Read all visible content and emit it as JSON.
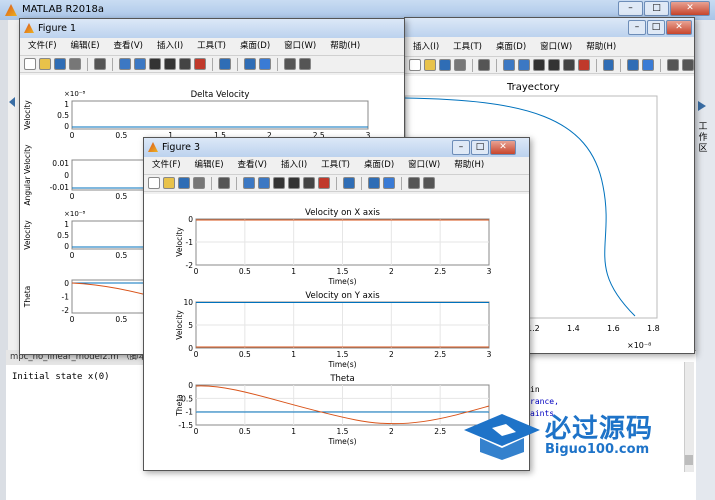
{
  "app": {
    "title": "MATLAB R2018a"
  },
  "side_panel_label": "工作区",
  "editor": {
    "tab_label": "mpc_no_linear_model2.m （脚本）",
    "line1": "Initial state x(0)",
    "frag1": "in",
    "frag2": "rance,",
    "frag3": "aints"
  },
  "menu": [
    "文件(F)",
    "编辑(E)",
    "查看(V)",
    "插入(I)",
    "工具(T)",
    "桌面(D)",
    "窗口(W)",
    "帮助(H)"
  ],
  "fig_back": {
    "title": "",
    "plot_title": "Trayectory",
    "x_ticks": [
      "1.2",
      "1.4",
      "1.6",
      "1.8"
    ],
    "x_exponent": "×10⁻⁸",
    "curve_color": "#0072bd"
  },
  "fig1": {
    "title": "Figure 1",
    "axes": [
      {
        "title": "Delta Velocity",
        "ylabel": "Velocity",
        "yticks": [
          "1",
          "0.5",
          "0"
        ],
        "exponent": "×10⁻⁸"
      },
      {
        "title": "",
        "ylabel": "Angular Velocity",
        "yticks": [
          "0.01",
          "0",
          "-0.01"
        ],
        "exponent": ""
      },
      {
        "title": "",
        "ylabel": "Velocity",
        "yticks": [
          "1",
          "0.5",
          "0"
        ],
        "exponent": "×10⁻⁸"
      },
      {
        "title": "",
        "ylabel": "Theta",
        "yticks": [
          "0",
          "-1",
          "-2"
        ],
        "exponent": ""
      }
    ],
    "xticks": [
      "0",
      "0.5",
      "1",
      "1.5",
      "2",
      "2.5",
      "3"
    ],
    "legend_frag1": "Velocity",
    "legend_frag2": "Angular Velocity"
  },
  "fig3": {
    "title": "Figure 3",
    "xlabel": "Time(s)",
    "xticks": [
      "0",
      "0.5",
      "1",
      "1.5",
      "2",
      "2.5",
      "3"
    ],
    "axes": [
      {
        "title": "Velocity on X axis",
        "ylabel": "Velocity",
        "yticks": [
          "0",
          "-1",
          "-2"
        ]
      },
      {
        "title": "Velocity on Y axis",
        "ylabel": "Velocity",
        "yticks": [
          "10",
          "5",
          "0"
        ]
      },
      {
        "title": "Theta",
        "ylabel": "Theta",
        "yticks": [
          "0",
          "-0.5",
          "-1",
          "-1.5"
        ]
      }
    ],
    "series_colors": {
      "blue": "#0072bd",
      "orange": "#d95319"
    }
  },
  "watermark": {
    "cn": "必过源码",
    "url": "Biguo100.com"
  }
}
